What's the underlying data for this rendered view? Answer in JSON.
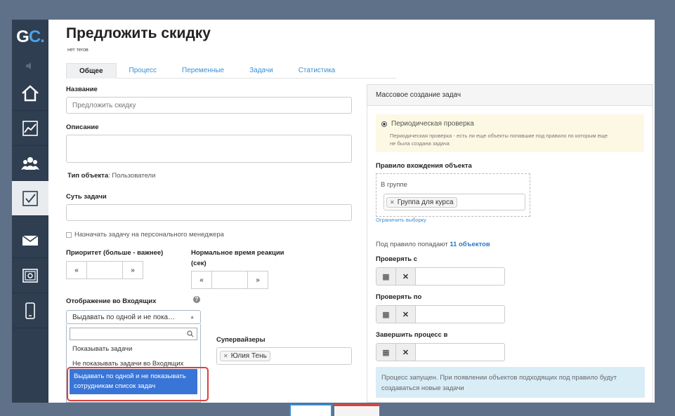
{
  "sidebar": {
    "logo_g": "G",
    "logo_c": "C.",
    "items": [
      {
        "name": "home"
      },
      {
        "name": "chart"
      },
      {
        "name": "users"
      },
      {
        "name": "tasks",
        "active": true
      },
      {
        "name": "mail"
      },
      {
        "name": "safe"
      },
      {
        "name": "mobile"
      }
    ]
  },
  "page": {
    "title": "Предложить скидку",
    "tags": "нет тегов"
  },
  "tabs": [
    "Общее",
    "Процесс",
    "Переменные",
    "Задачи",
    "Статистика"
  ],
  "form": {
    "name_label": "Название",
    "name_placeholder": "Предложить скидку",
    "description_label": "Описание",
    "object_type_label": "Тип объекта",
    "object_type_value": ": Пользователи",
    "essence_label": "Суть задачи",
    "assign_manager_label": "Назначать задачу на персонального менеджера",
    "priority_label": "Приоритет (больше - важнее)",
    "reaction_label_1": "Нормальное время реакции",
    "reaction_label_2": "(сек)",
    "inbox_label": "Отображение во Входящих",
    "inbox_selected": "Выдавать по одной и не пока…",
    "inbox_options": [
      "Показывать задачи",
      "Не показывать задачи во Входящих",
      "Выдавать по одной и не показывать",
      "сотрудникам список задач"
    ],
    "supervisors_label": "Супервайзеры",
    "supervisor_chip": "Юлия Тень"
  },
  "right_panel": {
    "header": "Массовое создание задач",
    "radio_label": "Периодическая проверка",
    "radio_desc_1": "Периодическая проверка - есть ли еще объекты попавшие под правило по которым еще",
    "radio_desc_2": "не была создана задача",
    "rule_label": "Правило вхождения объекта",
    "group_label": "В группе",
    "group_chip": "Группа для курса",
    "limit_link": "Ограничить выборку",
    "count_prefix": "Под правило попадают ",
    "count_link": "11 объектов",
    "check_from_label": "Проверять с",
    "check_to_label": "Проверять по",
    "finish_label": "Завершить процесс в",
    "info_1": "Процесс запущен. При появлении объектов подходящих под правило будут",
    "info_2": "создаваться новые задачи"
  },
  "icons": {
    "prev": "«",
    "next": "»",
    "calendar": "calendar-icon",
    "clear": "✕",
    "help": "?",
    "search": "search-icon"
  }
}
